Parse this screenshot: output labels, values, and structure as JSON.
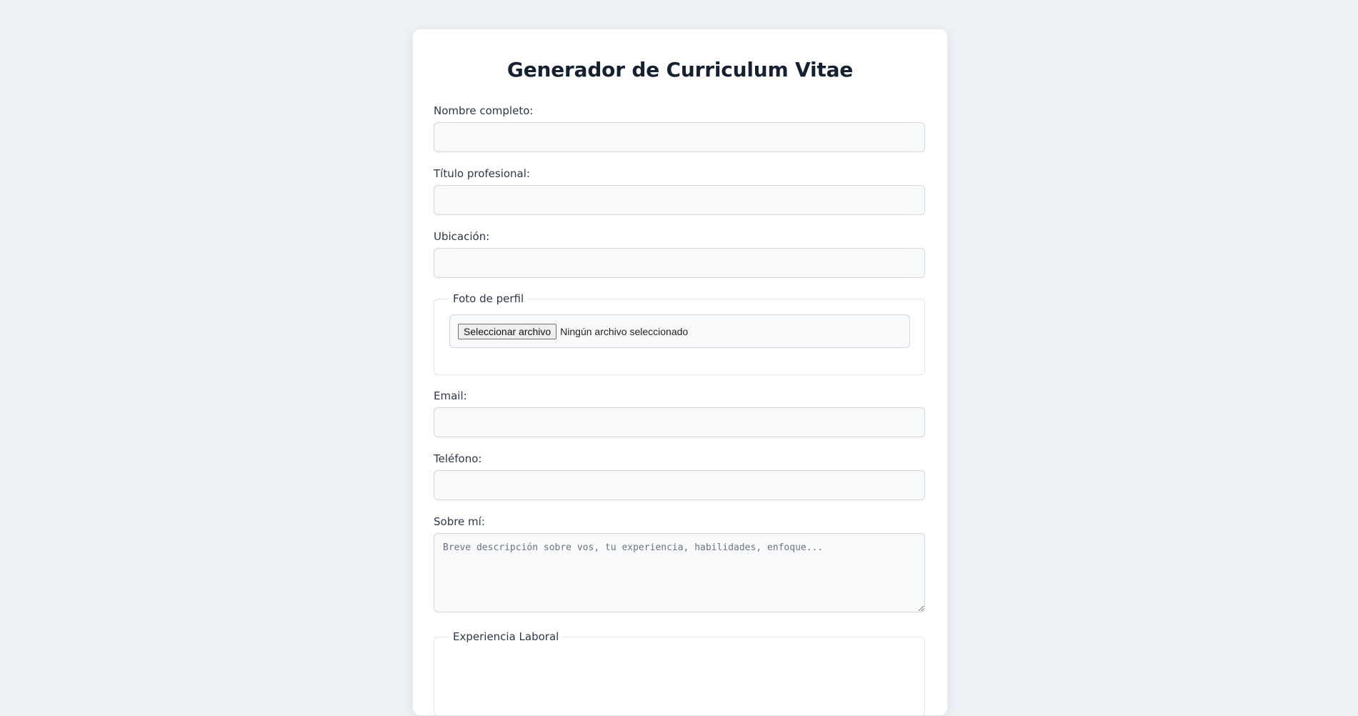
{
  "page": {
    "title": "Generador de Curriculum Vitae"
  },
  "form": {
    "nombre": {
      "label": "Nombre completo:",
      "value": ""
    },
    "titulo": {
      "label": "Título profesional:",
      "value": ""
    },
    "ubicacion": {
      "label": "Ubicación:",
      "value": ""
    },
    "foto": {
      "legend": "Foto de perfil",
      "button_label": "Seleccionar archivo",
      "status": "Ningún archivo seleccionado"
    },
    "email": {
      "label": "Email:",
      "value": ""
    },
    "telefono": {
      "label": "Teléfono:",
      "value": ""
    },
    "sobre_mi": {
      "label": "Sobre mí:",
      "placeholder": "Breve descripción sobre vos, tu experiencia, habilidades, enfoque...",
      "value": ""
    },
    "experiencia": {
      "legend": "Experiencia Laboral"
    }
  },
  "colors": {
    "background": "#edf1f5",
    "card": "#ffffff",
    "input_bg": "#f8f9fb",
    "input_border": "#cfd6de",
    "title": "#16202e"
  }
}
